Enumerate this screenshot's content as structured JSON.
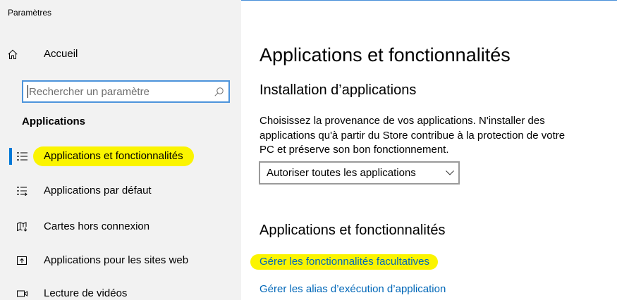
{
  "window": {
    "title": "Paramètres"
  },
  "sidebar": {
    "home": {
      "label": "Accueil",
      "icon": "home-icon"
    },
    "search": {
      "placeholder": "Rechercher un paramètre",
      "icon": "search-icon"
    },
    "section_title": "Applications",
    "items": [
      {
        "label": "Applications et fonctionnalités",
        "icon": "apps-features-icon",
        "selected": true,
        "highlighted": true
      },
      {
        "label": "Applications par défaut",
        "icon": "default-apps-icon",
        "selected": false,
        "highlighted": false
      },
      {
        "label": "Cartes hors connexion",
        "icon": "offline-maps-icon",
        "selected": false,
        "highlighted": false
      },
      {
        "label": "Applications pour les sites web",
        "icon": "apps-for-websites-icon",
        "selected": false,
        "highlighted": false
      },
      {
        "label": "Lecture de vidéos",
        "icon": "video-playback-icon",
        "selected": false,
        "highlighted": false
      }
    ]
  },
  "main": {
    "title": "Applications et fonctionnalités",
    "install_section": {
      "heading": "Installation d’applications",
      "description": "Choisissez la provenance de vos applications. N'installer des applications qu'à partir du Store contribue à la protection de votre PC et préserve son bon fonctionnement.",
      "source_dropdown": {
        "selected": "Autoriser toutes les applications",
        "icon": "chevron-down-icon"
      }
    },
    "apps_section": {
      "heading": "Applications et fonctionnalités",
      "links": [
        {
          "label": "Gérer les fonctionnalités facultatives",
          "highlighted": true
        },
        {
          "label": "Gérer les alias d’exécution d’application",
          "highlighted": false
        }
      ]
    }
  },
  "colors": {
    "sidebar_background": "#f2f2f2",
    "content_background": "#ffffff",
    "accent": "#0078d7",
    "search_border": "#4d94db",
    "link": "#0067b8",
    "highlighter": "#fbf400",
    "window_border": "#4a90d9"
  }
}
